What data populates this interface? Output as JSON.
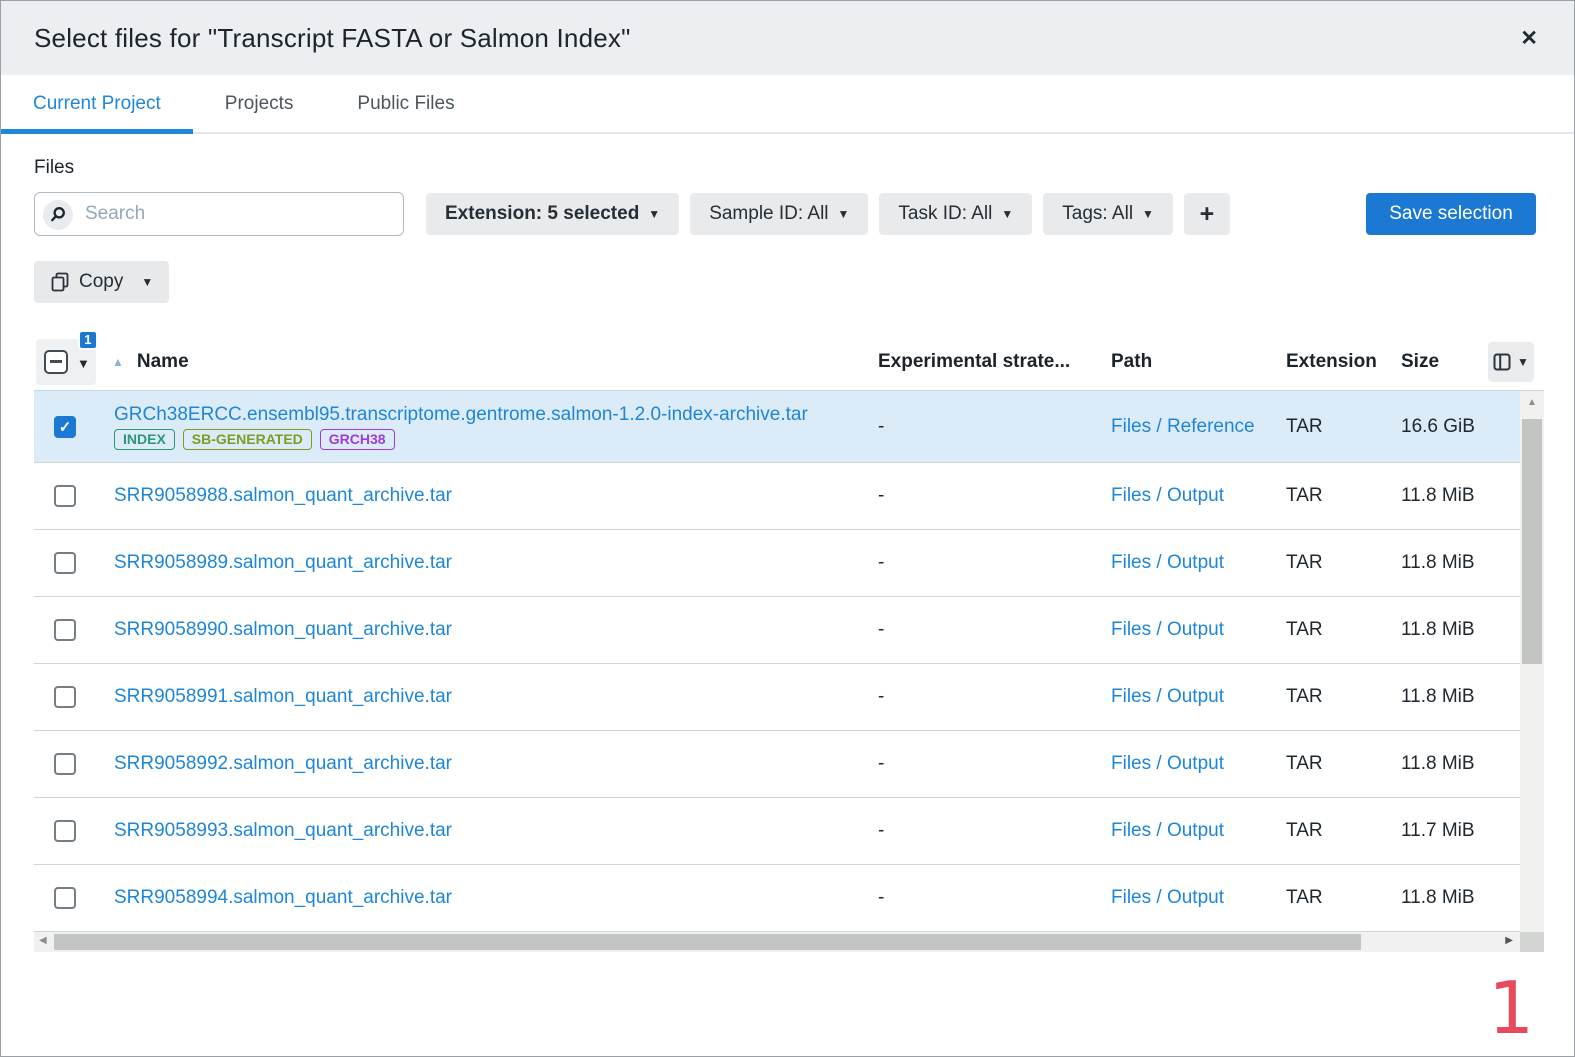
{
  "dialog": {
    "title": "Select files for \"Transcript FASTA or Salmon Index\"",
    "close_icon": "✕"
  },
  "tabs": [
    {
      "label": "Current Project",
      "active": true
    },
    {
      "label": "Projects",
      "active": false
    },
    {
      "label": "Public Files",
      "active": false
    }
  ],
  "files_panel": {
    "section_label": "Files",
    "search": {
      "placeholder": "Search"
    },
    "filters": [
      {
        "label": "Extension: 5 selected"
      },
      {
        "label": "Sample ID: All"
      },
      {
        "label": "Task ID: All"
      },
      {
        "label": "Tags: All"
      }
    ],
    "add_filter_label": "+",
    "save_button_label": "Save selection",
    "copy_button_label": "Copy"
  },
  "table": {
    "selection_badge": "1",
    "headers": {
      "name": "Name",
      "strategy": "Experimental strate...",
      "path": "Path",
      "extension": "Extension",
      "size": "Size"
    },
    "rows": [
      {
        "checked": true,
        "name": "GRCh38ERCC.ensembl95.transcriptome.gentrome.salmon-1.2.0-index-archive.tar",
        "tags": [
          "INDEX",
          "SB-GENERATED",
          "GRCH38"
        ],
        "strategy": "-",
        "path": "Files / Reference",
        "extension": "TAR",
        "size": "16.6 GiB"
      },
      {
        "checked": false,
        "name": "SRR9058988.salmon_quant_archive.tar",
        "tags": [],
        "strategy": "-",
        "path": "Files / Output",
        "extension": "TAR",
        "size": "11.8 MiB"
      },
      {
        "checked": false,
        "name": "SRR9058989.salmon_quant_archive.tar",
        "tags": [],
        "strategy": "-",
        "path": "Files / Output",
        "extension": "TAR",
        "size": "11.8 MiB"
      },
      {
        "checked": false,
        "name": "SRR9058990.salmon_quant_archive.tar",
        "tags": [],
        "strategy": "-",
        "path": "Files / Output",
        "extension": "TAR",
        "size": "11.8 MiB"
      },
      {
        "checked": false,
        "name": "SRR9058991.salmon_quant_archive.tar",
        "tags": [],
        "strategy": "-",
        "path": "Files / Output",
        "extension": "TAR",
        "size": "11.8 MiB"
      },
      {
        "checked": false,
        "name": "SRR9058992.salmon_quant_archive.tar",
        "tags": [],
        "strategy": "-",
        "path": "Files / Output",
        "extension": "TAR",
        "size": "11.8 MiB"
      },
      {
        "checked": false,
        "name": "SRR9058993.salmon_quant_archive.tar",
        "tags": [],
        "strategy": "-",
        "path": "Files / Output",
        "extension": "TAR",
        "size": "11.7 MiB"
      },
      {
        "checked": false,
        "name": "SRR9058994.salmon_quant_archive.tar",
        "tags": [],
        "strategy": "-",
        "path": "Files / Output",
        "extension": "TAR",
        "size": "11.8 MiB"
      }
    ]
  },
  "annotation": {
    "label": "1",
    "color": "#e8495c"
  },
  "colors": {
    "accent_blue": "#1b78d3",
    "link_blue": "#1e86d8",
    "selected_row_bg": "#dcebf8",
    "tag_colors": {
      "INDEX": "#2a9878",
      "SB-GENERATED": "#7e9b22",
      "GRCH38": "#a03bd8"
    }
  }
}
